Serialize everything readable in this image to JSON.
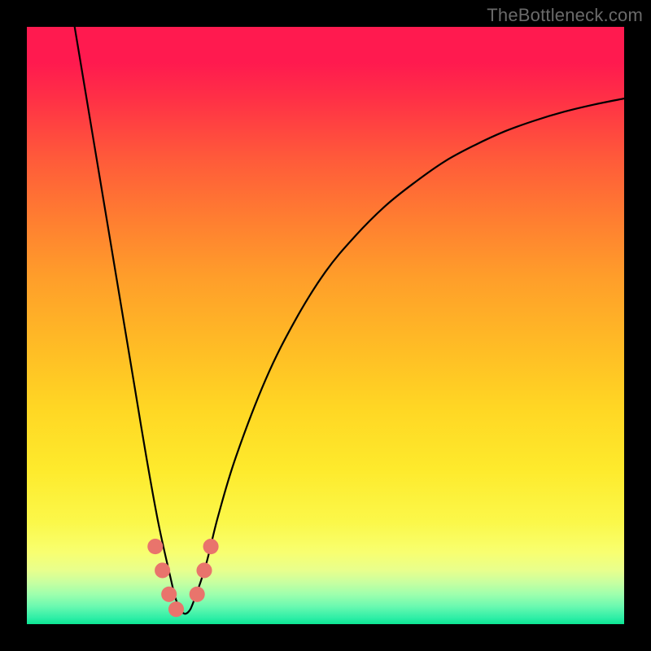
{
  "watermark": "TheBottleneck.com",
  "chart_data": {
    "type": "line",
    "title": "",
    "xlabel": "",
    "ylabel": "",
    "xlim": [
      0,
      100
    ],
    "ylim": [
      0,
      100
    ],
    "grid": false,
    "series": [
      {
        "name": "bottleneck-curve",
        "color": "#000000",
        "x": [
          8,
          10,
          12,
          14,
          16,
          18,
          20,
          22,
          24,
          25,
          26,
          27,
          28,
          30,
          32,
          35,
          40,
          45,
          50,
          55,
          60,
          65,
          70,
          75,
          80,
          85,
          90,
          95,
          100
        ],
        "y": [
          100,
          88,
          76,
          64,
          52,
          40,
          28,
          17,
          8,
          4,
          2,
          2,
          4,
          10,
          18,
          28,
          41,
          51,
          59,
          65,
          70,
          74,
          77.5,
          80.2,
          82.5,
          84.3,
          85.8,
          87,
          88
        ]
      }
    ],
    "markers": {
      "name": "highlight-points",
      "color": "#e9746c",
      "radius_pct": 1.3,
      "points": [
        {
          "x": 21.5,
          "y": 13.0
        },
        {
          "x": 22.7,
          "y": 9.0
        },
        {
          "x": 23.8,
          "y": 5.0
        },
        {
          "x": 25.0,
          "y": 2.5
        },
        {
          "x": 28.5,
          "y": 5.0
        },
        {
          "x": 29.7,
          "y": 9.0
        },
        {
          "x": 30.8,
          "y": 13.0
        }
      ]
    }
  }
}
